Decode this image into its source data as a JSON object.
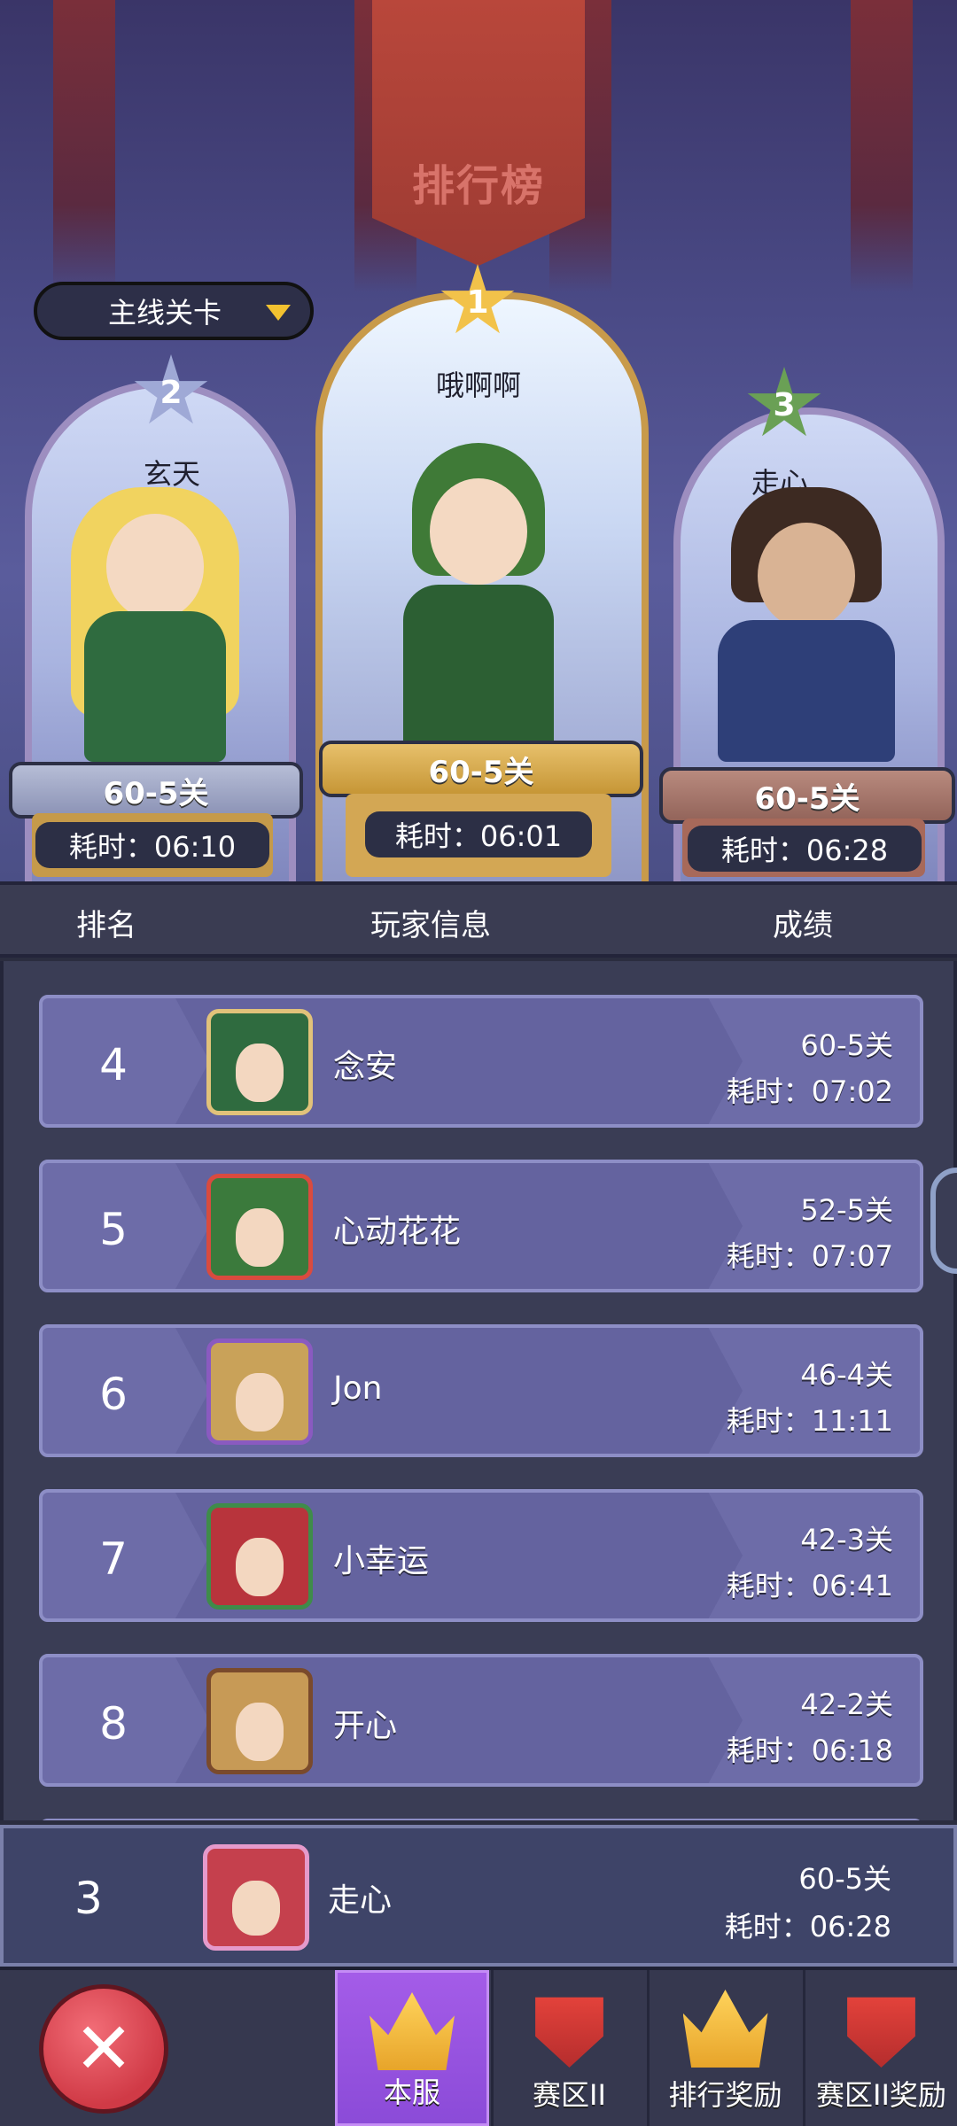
{
  "header": {
    "title": "排行榜"
  },
  "mode_select": {
    "label": "主线关卡"
  },
  "podium": [
    {
      "rank": "2",
      "name": "玄天",
      "stage": "60-5关",
      "time": "耗时：06:10"
    },
    {
      "rank": "1",
      "name": "哦啊啊",
      "stage": "60-5关",
      "time": "耗时：06:01"
    },
    {
      "rank": "3",
      "name": "走心",
      "stage": "60-5关",
      "time": "耗时：06:28"
    }
  ],
  "table": {
    "columns": {
      "rank": "排名",
      "player": "玩家信息",
      "score": "成绩"
    },
    "rows": [
      {
        "rank": "4",
        "name": "念安",
        "stage": "60-5关",
        "time": "耗时：07:02"
      },
      {
        "rank": "5",
        "name": "心动花花",
        "stage": "52-5关",
        "time": "耗时：07:07"
      },
      {
        "rank": "6",
        "name": "Jon",
        "stage": "46-4关",
        "time": "耗时：11:11"
      },
      {
        "rank": "7",
        "name": "小幸运",
        "stage": "42-3关",
        "time": "耗时：06:41"
      },
      {
        "rank": "8",
        "name": "开心",
        "stage": "42-2关",
        "time": "耗时：06:18"
      }
    ]
  },
  "my_rank": {
    "rank": "3",
    "name": "走心",
    "stage": "60-5关",
    "time": "耗时：06:28"
  },
  "bottom_nav": {
    "tabs": [
      {
        "label": "本服",
        "icon": "crown-icon",
        "active": true
      },
      {
        "label": "赛区II",
        "icon": "trophy-shield-icon",
        "active": false
      },
      {
        "label": "排行奖励",
        "icon": "crown-gem-icon",
        "active": false
      },
      {
        "label": "赛区II奖励",
        "icon": "trophy-chest-icon",
        "active": false
      }
    ]
  },
  "colors": {
    "accent_purple": "#a45ce8",
    "gold": "#e7a42a",
    "close_red": "#d03a46",
    "row_bg": "#6d6ca8"
  }
}
